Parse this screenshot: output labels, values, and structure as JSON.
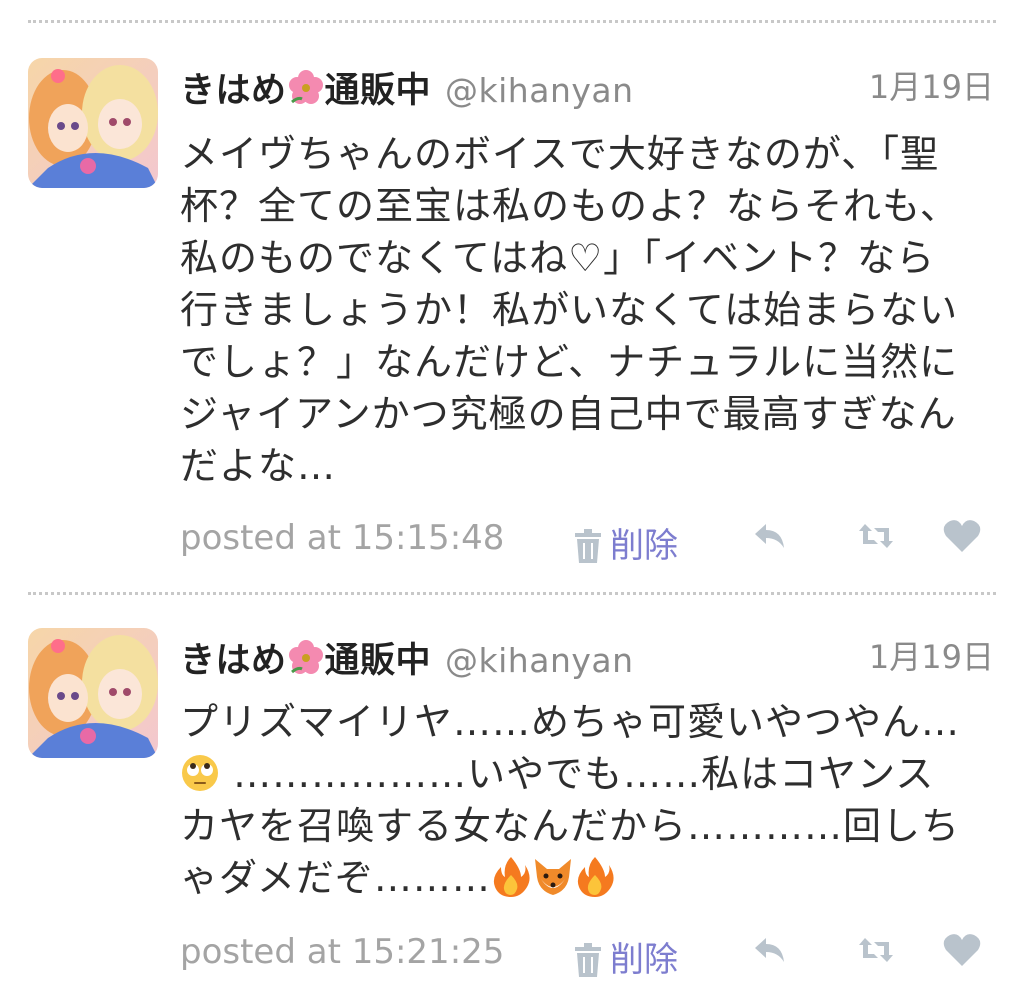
{
  "tweets": [
    {
      "name_part1": "きはめ",
      "name_part2": "通販中",
      "handle": "@kihanyan",
      "date": "1月19日",
      "body_lines": [
        "メイヴちゃんのボイスで大好きなのが、「聖",
        "杯？全ての至宝は私のものよ？ならそれも、",
        "私のものでなくてはね♡」「イベント？なら",
        "行きましょうか！私がいなくては始まらない",
        "でしょ？」なんだけど、ナチュラルに当然に",
        "ジャイアンかつ究極の自己中で最高すぎなん",
        "だよな…"
      ],
      "posted": "posted at 15:15:48",
      "delete_label": "削除"
    },
    {
      "name_part1": "きはめ",
      "name_part2": "通販中",
      "handle": "@kihanyan",
      "date": "1月19日",
      "body_line1": "プリズマイリヤ……めちゃ可愛いやつやん…",
      "body_line2": " ………………いやでも……私はコヤンス",
      "body_line3": "カヤを召喚する女なんだから…………回しち",
      "body_line4": "ゃダメだぞ………",
      "emoji_sequence": [
        "rolling-eyes-emoji",
        "fire-emoji",
        "fox-emoji",
        "fire-emoji"
      ],
      "posted": "posted at 15:21:25",
      "delete_label": "削除"
    }
  ],
  "colors": {
    "name": "#222222",
    "meta": "#8a8a8a",
    "body": "#2e2e2e",
    "posted": "#a4a4a4",
    "delete": "#7d7dcf",
    "icon": "#b9c3cc"
  }
}
